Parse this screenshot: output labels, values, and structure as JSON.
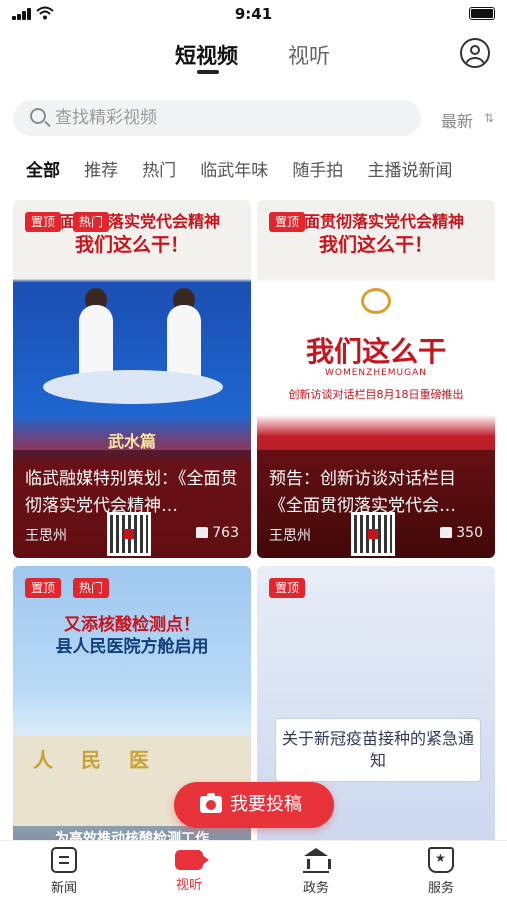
{
  "status": {
    "time": "9:41"
  },
  "header": {
    "tabs": [
      "短视频",
      "视听"
    ]
  },
  "search": {
    "placeholder": "查找精彩视频",
    "sort_label": "最新",
    "sort_icon": "sort-arrows-icon"
  },
  "categories": [
    "全部",
    "推荐",
    "热门",
    "临武年味",
    "随手拍",
    "主播说新闻"
  ],
  "cards": [
    {
      "badges": [
        "置顶",
        "热门"
      ],
      "banner_line1": "全面贯彻落实党代会精神",
      "banner_line2": "我们这么干！",
      "strip_title": "武水篇",
      "caption": "临武融媒特别策划：《全面贯彻落实党代会精神…",
      "author": "王思州",
      "likes": "763"
    },
    {
      "badges": [
        "置顶"
      ],
      "banner_line1": "全面贯彻落实党代会精神",
      "banner_line2": "我们这么干！",
      "center_title": "我们这么干",
      "center_sub": "WOMENZHEMUGAN",
      "center_note": "创新访谈对话栏目8月18日重磅推出",
      "caption": "预告：创新访谈对话栏目《全面贯彻落实党代会…",
      "author": "王思州",
      "likes": "350"
    },
    {
      "badges": [
        "置顶",
        "热门"
      ],
      "title_line1": "又添核酸检测点！",
      "title_line2": "县人民医院方舱启用",
      "sign": "人民医",
      "bottom_text": "为高效推动核酸检测工作"
    },
    {
      "badges": [
        "置顶"
      ],
      "note": "关于新冠疫苗接种的紧急通知"
    }
  ],
  "submit_button": {
    "label": "我要投稿",
    "icon": "camera-icon"
  },
  "bottom_nav": [
    {
      "label": "新闻",
      "icon": "news-icon"
    },
    {
      "label": "视听",
      "icon": "video-icon",
      "active": true
    },
    {
      "label": "政务",
      "icon": "government-icon"
    },
    {
      "label": "服务",
      "icon": "service-icon"
    }
  ],
  "colors": {
    "accent": "#e8323a",
    "badge": "#e2262d",
    "banner_red": "#c8141c"
  }
}
